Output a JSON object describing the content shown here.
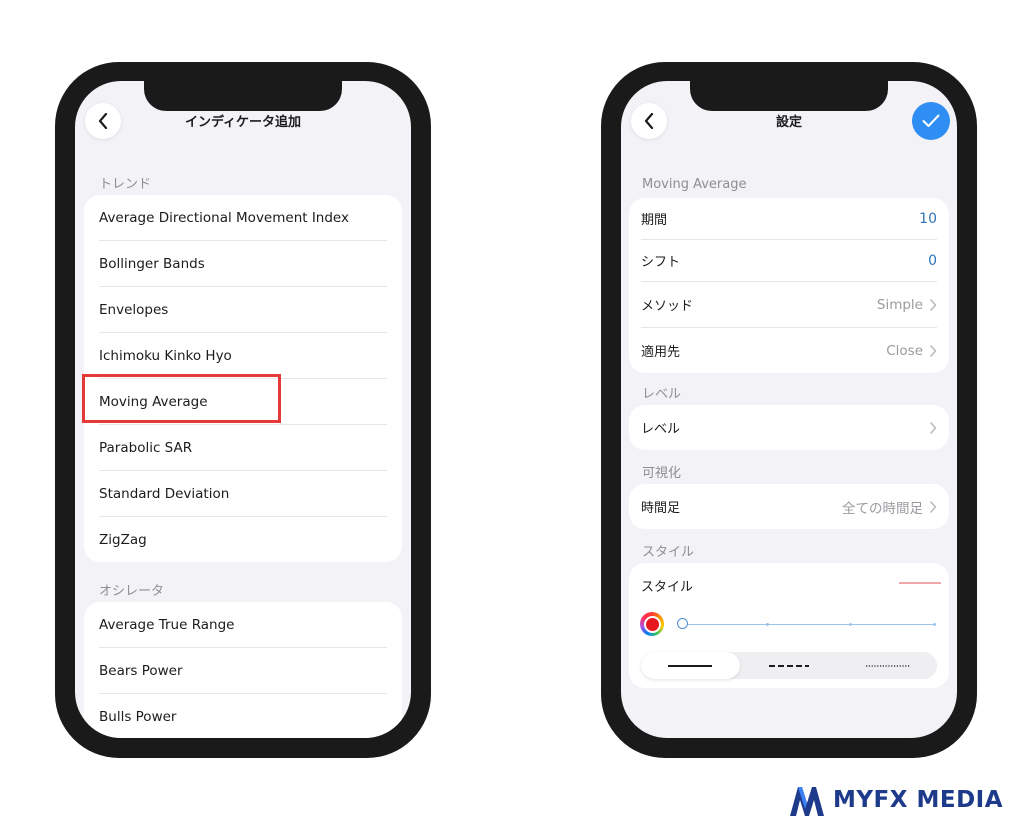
{
  "left_screen": {
    "title": "インディケータ追加",
    "sections": [
      {
        "label": "トレンド",
        "items": [
          "Average Directional Movement Index",
          "Bollinger Bands",
          "Envelopes",
          "Ichimoku Kinko Hyo",
          "Moving Average",
          "Parabolic SAR",
          "Standard Deviation",
          "ZigZag"
        ]
      },
      {
        "label": "オシレータ",
        "items": [
          "Average True Range",
          "Bears Power",
          "Bulls Power"
        ]
      }
    ],
    "highlighted_item": "Moving Average",
    "highlight_color": "#e53935"
  },
  "right_screen": {
    "title": "設定",
    "section_indicator": "Moving Average",
    "parameters": [
      {
        "label": "期間",
        "value": "10"
      },
      {
        "label": "シフト",
        "value": "0"
      },
      {
        "label": "メソッド",
        "value": "Simple"
      },
      {
        "label": "適用先",
        "value": "Close"
      }
    ],
    "section_levels": "レベル",
    "levels_row": "レベル",
    "section_visualization": "可視化",
    "timeframe_label": "時間足",
    "timeframe_value": "全ての時間足",
    "section_style": "スタイル",
    "style_label": "スタイル",
    "line_color": "#e6171f",
    "preview_line_color": "#f0a7a7",
    "line_width_level": 1,
    "line_styles": [
      "solid",
      "dashed",
      "dotted"
    ],
    "selected_line_style": "solid"
  },
  "brand": {
    "name": "MYFX MEDIA",
    "color": "#1e3a8a"
  },
  "colors": {
    "accent_blue": "#2f8ef4",
    "value_blue": "#2f74b5",
    "background": "#f2f2f7"
  }
}
